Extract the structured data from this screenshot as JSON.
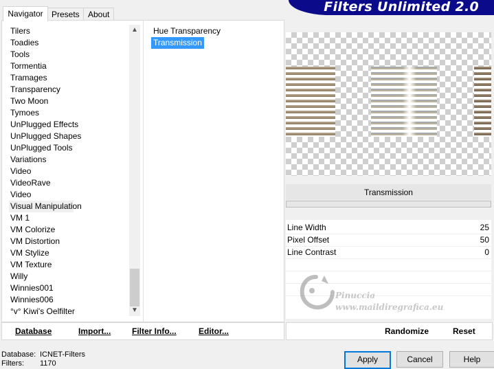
{
  "tabs": [
    {
      "label": "Navigator"
    },
    {
      "label": "Presets"
    },
    {
      "label": "About"
    }
  ],
  "banner": {
    "title": "Filters Unlimited 2.0"
  },
  "categories": {
    "items": [
      "Tilers",
      "Toadies",
      "Tools",
      "Tormentia",
      "Tramages",
      "Transparency",
      "Two Moon",
      "Tymoes",
      "UnPlugged Effects",
      "UnPlugged Shapes",
      "UnPlugged Tools",
      "Variations",
      "Video",
      "VideoRave",
      "Video",
      "Visual Manipulation",
      "VM 1",
      "VM Colorize",
      "VM Distortion",
      "VM Stylize",
      "VM Texture",
      "Willy",
      "Winnies001",
      "Winnies006",
      "°v° Kiwi's Oelfilter"
    ],
    "selected": "Visual Manipulation"
  },
  "filters": {
    "items": [
      "Hue Transparency",
      "Transmission"
    ],
    "selected": "Transmission"
  },
  "left_buttons": {
    "database": "Database",
    "import": "Import...",
    "filter_info": "Filter Info...",
    "editor": "Editor..."
  },
  "preview": {
    "filter_name": "Transmission"
  },
  "params": [
    {
      "name": "Line Width",
      "value": "25"
    },
    {
      "name": "Pixel Offset",
      "value": "50"
    },
    {
      "name": "Line Contrast",
      "value": "0"
    }
  ],
  "watermark": {
    "line1": "Pinuccia",
    "line2": "www.maildiregrafica.eu"
  },
  "right_buttons": {
    "randomize": "Randomize",
    "reset": "Reset"
  },
  "status": {
    "database_label": "Database:",
    "database_value": "ICNET-Filters",
    "filters_label": "Filters:",
    "filters_value": "1170"
  },
  "dialog_buttons": {
    "apply": "Apply",
    "cancel": "Cancel",
    "help": "Help"
  },
  "colors": {
    "banner": "#0a0a8a",
    "selection": "#3399ff"
  }
}
